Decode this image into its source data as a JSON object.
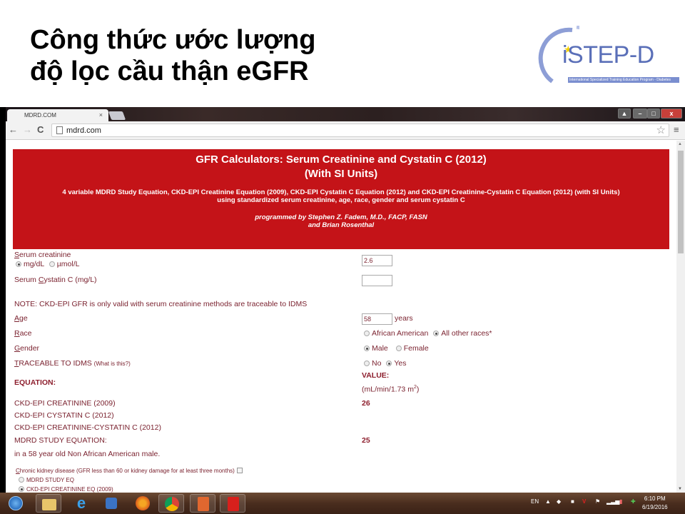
{
  "slide": {
    "title_line1": "Công thức ước lượng",
    "title_line2": "độ lọc cầu thận eGFR",
    "logo": {
      "name": "iSTEP-D",
      "subtitle": "International Specialized Training Education Program - Diabetes",
      "accent_color": "#5a6fb8",
      "star_color": "#f4d000"
    }
  },
  "browser": {
    "tab_title": "MDRD.COM",
    "tab_close": "×",
    "url": "mdrd.com",
    "nav": {
      "back": "←",
      "forward": "→",
      "reload": "C"
    },
    "bookmark_star": "☆",
    "menu": "≡",
    "window_buttons": {
      "minimize": "–",
      "maximize": "□",
      "close": "x"
    }
  },
  "page": {
    "banner": {
      "title_line1": "GFR Calculators: Serum Creatinine and Cystatin C (2012)",
      "title_line2": "(With SI Units)",
      "description": "4 variable MDRD Study Equation, CKD-EPI Creatinine Equation (2009), CKD-EPI Cystatin C Equation (2012) and CKD-EPI Creatinine-Cystatin C Equation (2012) (with SI Units)",
      "description2": "using standardized serum creatinine, age, race, gender and serum cystatin C",
      "credits_line1": "programmed by Stephen Z. Fadem, M.D., FACP, FASN",
      "credits_line2": "and Brian Rosenthal",
      "background_color": "#c41318"
    },
    "form": {
      "serum_creatinine": {
        "label_accesskey": "S",
        "label_rest": "erum creatinine",
        "value": "2.6",
        "unit_options": [
          {
            "label": "mg/dL",
            "selected": true
          },
          {
            "label": "µmol/L",
            "selected": false
          }
        ]
      },
      "cystatin": {
        "label_pre": "Serum ",
        "label_accesskey": "C",
        "label_rest": "ystatin C (mg/L)",
        "value": ""
      },
      "note": "NOTE: CKD-EPI GFR is only valid with serum creatinine methods are traceable to IDMS",
      "age": {
        "label_accesskey": "A",
        "label_rest": "ge",
        "value": "58",
        "unit": "years"
      },
      "race": {
        "label_accesskey": "R",
        "label_rest": "ace",
        "options": [
          {
            "label": "African American",
            "selected": false
          },
          {
            "label": "All other races*",
            "selected": true
          }
        ]
      },
      "gender": {
        "label_accesskey": "G",
        "label_rest": "ender",
        "options": [
          {
            "label": "Male",
            "selected": true
          },
          {
            "label": "Female",
            "selected": false
          }
        ]
      },
      "idms": {
        "label_accesskey": "T",
        "label_rest": "RACEABLE TO IDMS",
        "help_link": "(What is this?)",
        "options": [
          {
            "label": "No",
            "selected": false
          },
          {
            "label": "Yes",
            "selected": true
          }
        ]
      }
    },
    "results": {
      "equation_header": "EQUATION:",
      "value_header": "VALUE:",
      "value_unit": "(mL/min/1.73 m",
      "value_unit_sup": "2",
      "value_unit_close": ")",
      "rows": [
        {
          "equation": "CKD-EPI CREATININE (2009)",
          "value": "26"
        },
        {
          "equation": "CKD-EPI CYSTATIN C (2012)",
          "value": ""
        },
        {
          "equation": "CKD-EPI CREATININE-CYSTATIN C (2012)",
          "value": ""
        },
        {
          "equation": "MDRD STUDY EQUATION:",
          "value": "25"
        }
      ],
      "summary": "in a 58 year old Non African American male."
    },
    "ckd": {
      "label_accesskey": "C",
      "label_rest": "hronic kidney disease (GFR less than 60 or kidney damage for at least three months)",
      "checked": false,
      "options": [
        {
          "label": "MDRD STUDY EQ",
          "selected": false
        },
        {
          "label": "CKD-EPI CREATININE EQ (2009)",
          "selected": true
        }
      ]
    }
  },
  "taskbar": {
    "apps": [
      "start",
      "file-explorer",
      "internet-explorer",
      "media-player",
      "firefox",
      "chrome",
      "powerpoint",
      "acrobat"
    ],
    "tray": {
      "language": "EN"
    },
    "clock": {
      "time": "6:10 PM",
      "date": "6/19/2016"
    }
  }
}
